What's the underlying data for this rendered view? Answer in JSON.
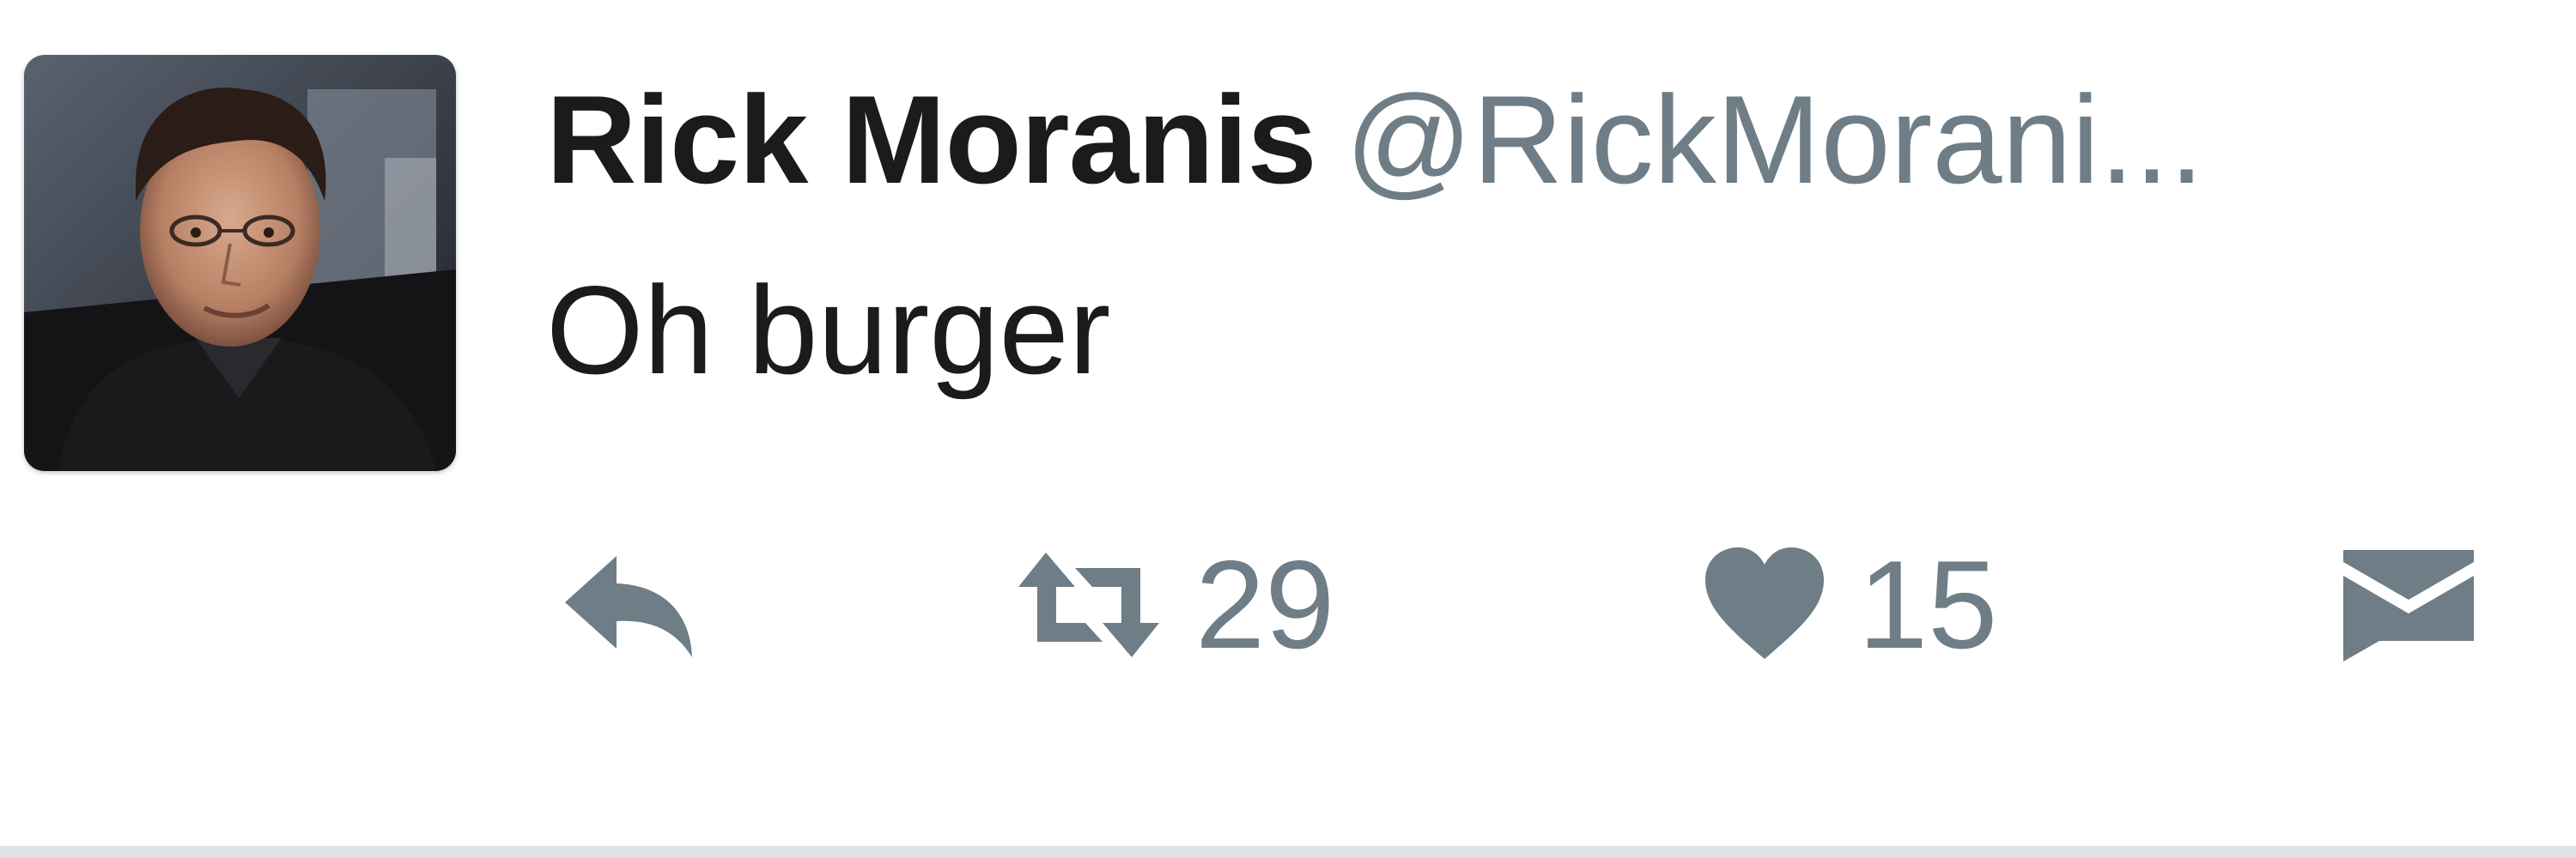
{
  "tweet": {
    "display_name": "Rick Moranis",
    "handle": "@RickMorani...",
    "text": "Oh burger"
  },
  "actions": {
    "reply_icon": "reply-icon",
    "retweet_icon": "retweet-icon",
    "retweet_count": "29",
    "like_icon": "heart-icon",
    "like_count": "15",
    "dm_icon": "envelope-icon"
  },
  "colors": {
    "name": "#1b1b1b",
    "handle": "#6f7d87",
    "icon": "#6f7d87",
    "background": "#ffffff",
    "divider": "#dfe3e6"
  }
}
